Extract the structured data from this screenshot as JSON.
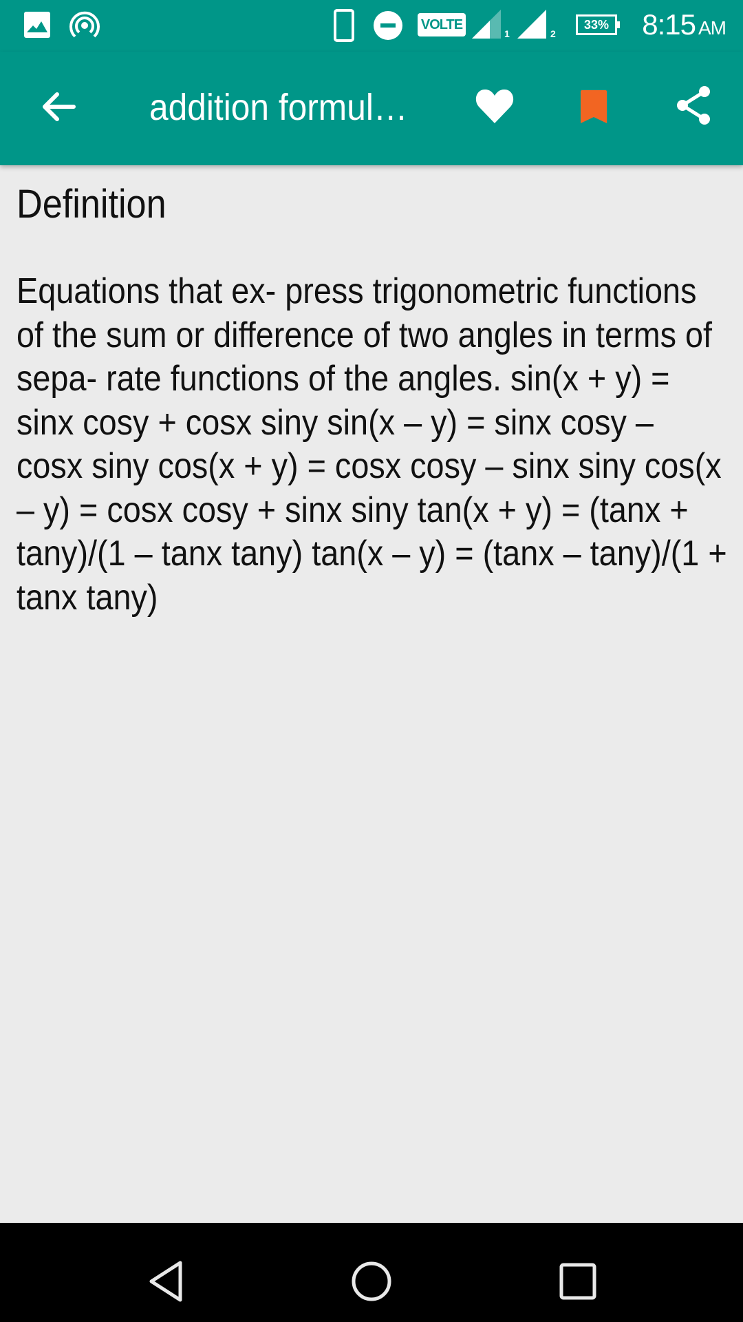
{
  "status_bar": {
    "left_icons": [
      "gallery-icon",
      "hotspot-icon"
    ],
    "right_icons": [
      "phone-icon",
      "do-not-disturb-icon",
      "volte-badge",
      "signal-sim1-icon",
      "signal-sim2-icon",
      "battery-icon"
    ],
    "volte_label": "VOLTE",
    "sim1_label": "1",
    "sim2_label": "2",
    "battery_label": "33%",
    "time": "8:15",
    "ampm": "AM"
  },
  "app_bar": {
    "title": "addition formulas",
    "actions": [
      "favorite-heart-icon",
      "bookmark-icon",
      "share-icon"
    ],
    "colors": {
      "background": "#009688",
      "bookmark": "#f26522"
    }
  },
  "content": {
    "heading": "Definition",
    "body": "Equations that ex- press trigonometric functions of the sum or difference of two angles in terms of sepa- rate functions of the angles. sin(x + y) = sinx cosy + cosx siny sin(x – y) = sinx cosy – cosx siny cos(x + y) = cosx cosy – sinx siny cos(x – y) = cosx cosy + sinx siny tan(x + y) = (tanx + tany)/(1 – tanx tany) tan(x – y) = (tanx – tany)/(1 + tanx tany)"
  },
  "nav_bar": {
    "buttons": [
      "back",
      "home",
      "recents"
    ]
  }
}
